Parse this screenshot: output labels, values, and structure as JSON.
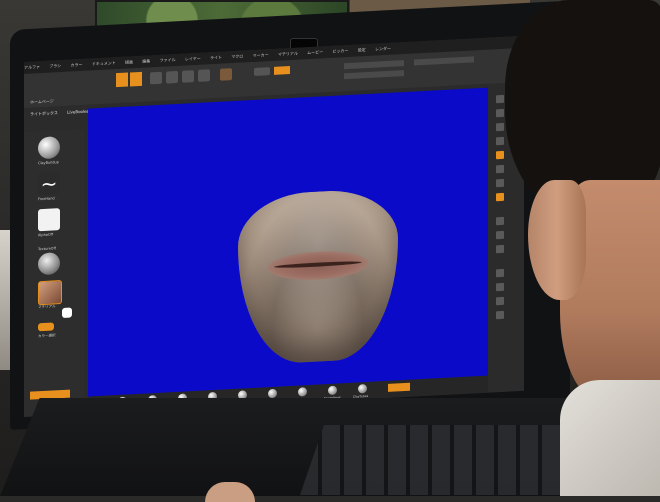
{
  "app": {
    "title": "ZBrush 2021",
    "accent_color": "#e7901d",
    "canvas_color": "#0a0ac8"
  },
  "menu": {
    "items": [
      "アルファ",
      "ブラシ",
      "カラー",
      "ドキュメント",
      "描画",
      "編集",
      "ファイル",
      "レイヤー",
      "ライト",
      "マクロ",
      "マーカー",
      "マテリアル",
      "ムービー",
      "ピッカー",
      "設定",
      "レンダー",
      "ステンシル",
      "ストローク",
      "テクスチャ",
      "ツール",
      "トランスフォーム",
      "Zプラグイン",
      "Zスクリプト"
    ]
  },
  "toolbar": {
    "home_tab": "ホームページ",
    "lightbox_tab": "ライトボックス",
    "liveboolean": "LiveBoolean"
  },
  "leftshelf": {
    "items": [
      {
        "label": "ClayBuildup",
        "icon": "sphere-brush-icon"
      },
      {
        "label": "FreeHand",
        "icon": "stroke-icon"
      },
      {
        "label": "AlphaOff",
        "icon": "alpha-icon"
      },
      {
        "label": "TextureOff",
        "icon": "texture-icon"
      },
      {
        "label": "マテリアル",
        "icon": "material-icon"
      },
      {
        "label": "カラー選択",
        "icon": "color-icon"
      }
    ]
  },
  "bottomshelf": {
    "items": [
      "Standard",
      "Move",
      "Clay",
      "DamStandard",
      "hPolish",
      "Inflat",
      "TrimDynamic",
      "SnakeHook",
      "ClayTubes"
    ]
  }
}
